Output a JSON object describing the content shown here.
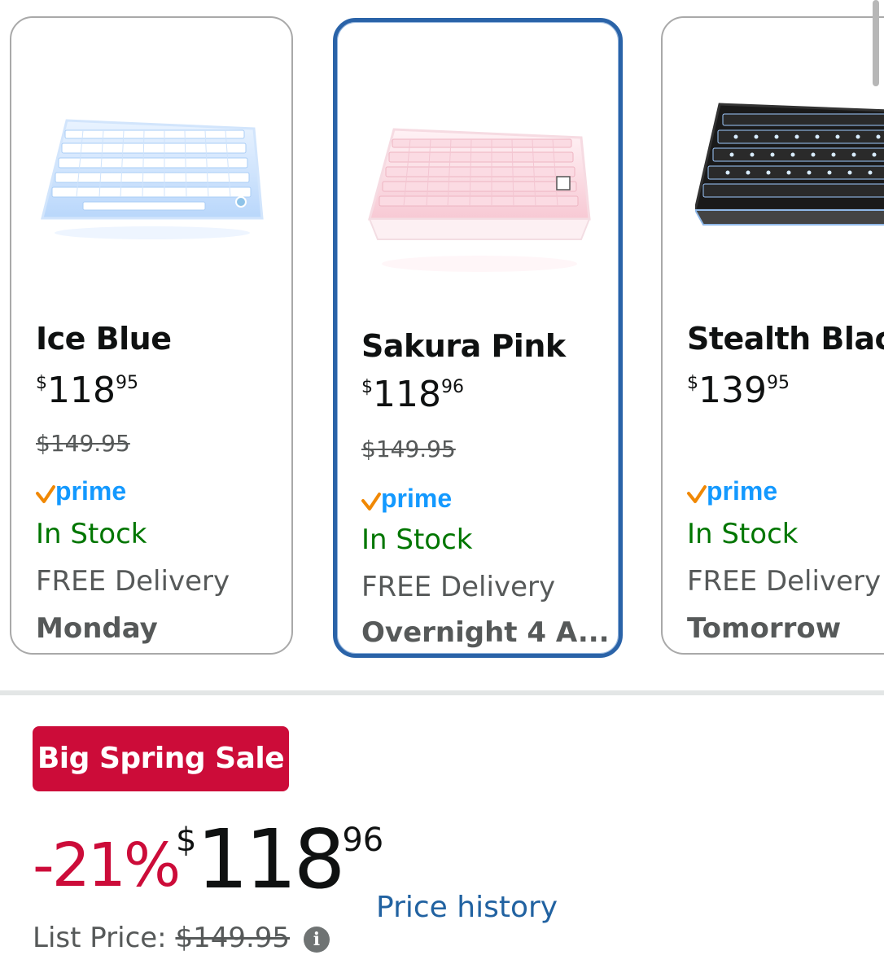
{
  "variants": [
    {
      "name": "Ice Blue",
      "price_symbol": "$",
      "price_whole": "118",
      "price_fraction": "95",
      "list_price": "$149.95",
      "prime": "prime",
      "stock": "In Stock",
      "delivery": "FREE Delivery",
      "delivery_day": "Monday",
      "color": "#cfe4fb"
    },
    {
      "name": "Sakura Pink",
      "price_symbol": "$",
      "price_whole": "118",
      "price_fraction": "96",
      "list_price": "$149.95",
      "prime": "prime",
      "stock": "In Stock",
      "delivery": "FREE Delivery",
      "delivery_day": "Overnight 4 A...",
      "color": "#fbd9e1",
      "selected": true
    },
    {
      "name": "Stealth Blac",
      "price_symbol": "$",
      "price_whole": "139",
      "price_fraction": "95",
      "prime": "prime",
      "stock": "In Stock",
      "delivery": "FREE Delivery",
      "delivery_day": "Tomorrow",
      "color": "#1b1b1b"
    }
  ],
  "deal": {
    "badge": "Big Spring Sale",
    "discount": "-21%",
    "price_symbol": "$",
    "price_whole": "118",
    "price_fraction": "96",
    "price_history_link": "Price history",
    "list_price_label": "List Price:",
    "list_price_value": "$149.95",
    "info_icon": "i"
  },
  "colors": {
    "prime_blue": "#1399ff",
    "prime_check": "#f08804",
    "stock_green": "#007600",
    "sale_red": "#cc0c39",
    "link_blue": "#2162a1",
    "selected_border": "#2a63a8"
  }
}
